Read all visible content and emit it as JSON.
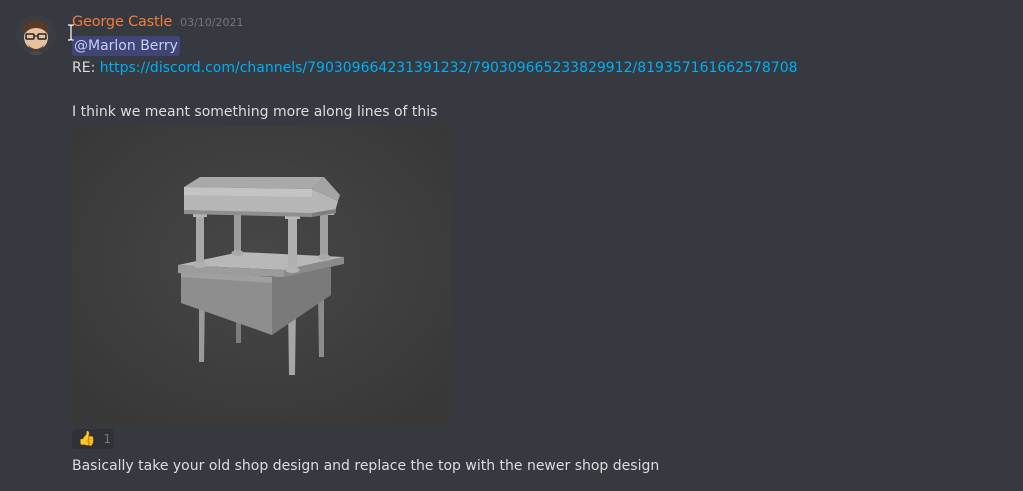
{
  "message": {
    "author": "George Castle",
    "timestamp": "03/10/2021",
    "mention": "@Marlon Berry",
    "re_prefix": "RE: ",
    "link": "https://discord.com/channels/790309664231391232/790309665233829912/819357161662578708",
    "body": "I think we meant something more along lines of this",
    "attachment": {
      "icon": "3d-shop-stall-render"
    },
    "reaction": {
      "emoji": "👍",
      "count": "1"
    },
    "followup": "Basically take your old shop design and replace the top with the newer shop design"
  },
  "colors": {
    "background": "#36393f",
    "username": "#f47b38",
    "link": "#00aff4",
    "mention_bg": "rgba(88,101,242,0.3)",
    "mention_text": "#c9cdfb"
  }
}
